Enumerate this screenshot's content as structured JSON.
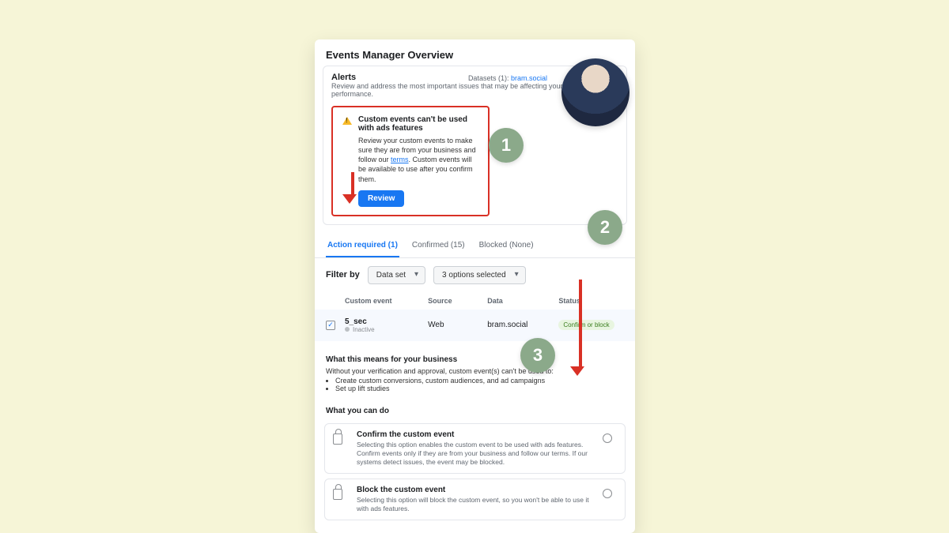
{
  "page": {
    "title": "Events Manager Overview"
  },
  "alerts": {
    "heading": "Alerts",
    "subheading": "Review and address the most important issues that may be affecting your business' performance.",
    "datasets_label": "Datasets (1):",
    "datasets_link": "bram.social"
  },
  "alert_card": {
    "title": "Custom events can't be used with ads features",
    "body_pre": "Review your custom events to make sure they are from your business and follow our ",
    "terms_text": "terms",
    "body_post": ". Custom events will be available to use after you confirm them.",
    "review_label": "Review"
  },
  "tabs": [
    {
      "label": "Action required (1)",
      "active": true
    },
    {
      "label": "Confirmed (15)",
      "active": false
    },
    {
      "label": "Blocked (None)",
      "active": false
    }
  ],
  "filter": {
    "label": "Filter by",
    "select1": "Data set",
    "select2": "3 options selected"
  },
  "table": {
    "headers": {
      "event": "Custom event",
      "source": "Source",
      "data": "Data",
      "status": "Status"
    },
    "rows": [
      {
        "name": "5_sec",
        "state": "Inactive",
        "source": "Web",
        "data": "bram.social",
        "status": "Confirm or block"
      }
    ]
  },
  "means": {
    "heading": "What this means for your business",
    "lead": "Without your verification and approval, custom event(s) can't be used to:",
    "items": [
      "Create custom conversions, custom audiences, and ad campaigns",
      "Set up lift studies"
    ]
  },
  "cando": {
    "heading": "What you can do",
    "options": [
      {
        "title": "Confirm the custom event",
        "desc": "Selecting this option enables the custom event to be used with ads features. Confirm events only if they are from your business and follow our terms. If our systems detect issues, the event may be blocked."
      },
      {
        "title": "Block the custom event",
        "desc": "Selecting this option will block the custom event, so you won't be able to use it with ads features."
      }
    ]
  },
  "annotations": {
    "b1": "1",
    "b2": "2",
    "b3": "3"
  }
}
